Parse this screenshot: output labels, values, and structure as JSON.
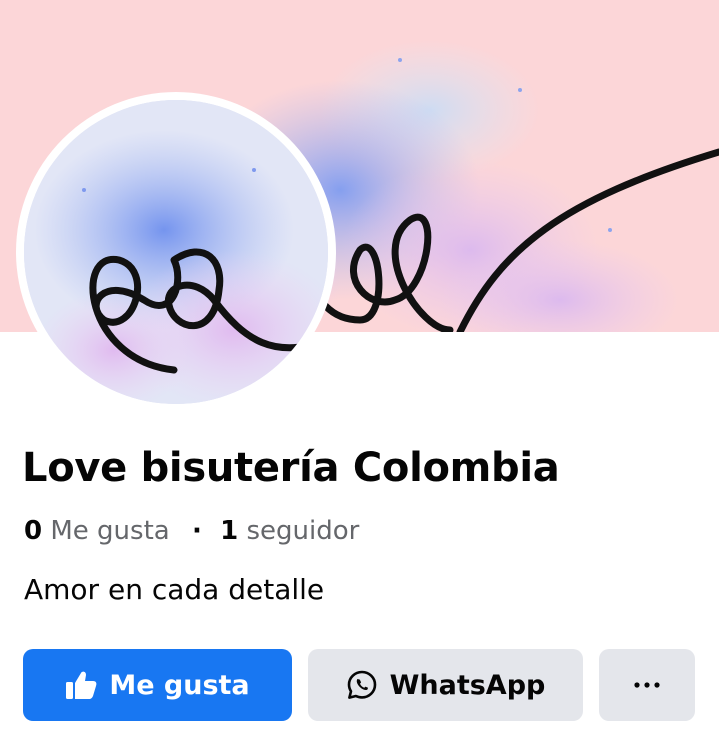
{
  "page": {
    "name": "Love bisutería Colombia",
    "likes_count": "0",
    "likes_label": "Me gusta",
    "separator": "·",
    "followers_count": "1",
    "followers_label": "seguidor",
    "tagline": "Amor en cada detalle"
  },
  "actions": {
    "like_label": "Me gusta",
    "whatsapp_label": "WhatsApp",
    "like_icon": "thumbs-up-icon",
    "whatsapp_icon": "whatsapp-icon",
    "more_icon": "more-horizontal-icon"
  },
  "colors": {
    "primary_button": "#1877f2",
    "secondary_button": "#e4e6eb",
    "cover_background": "#fcd6d8",
    "secondary_text": "#65676b"
  }
}
